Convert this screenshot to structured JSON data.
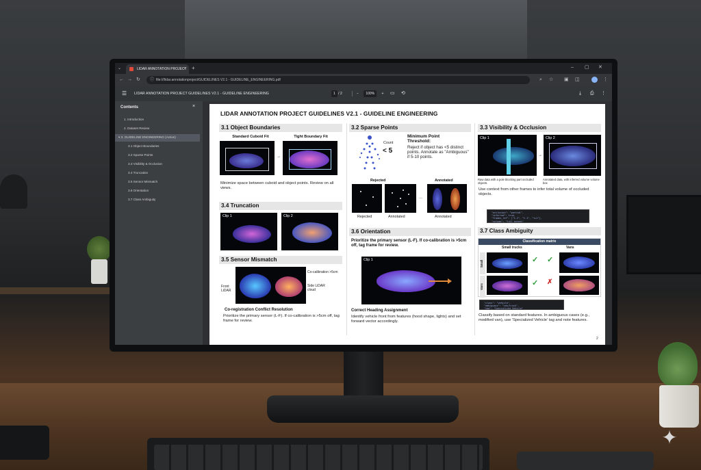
{
  "browser": {
    "tab_title": "LIDAR ANNOTATION PROJECT",
    "new_tab": "+",
    "url": "file:///lidar.annotationproject/GUIDELINES V2.1 - GUIDELINE_ENGINEERING.pdf"
  },
  "pdf_toolbar": {
    "title": "LIDAR ANNOTATION PROJECT GUIDELINES V2.1 - GUIDELINE ENGINEERING",
    "page_current": "1",
    "page_total": "/ 2",
    "zoom": "100%",
    "zoom_out": "−",
    "zoom_in": "+"
  },
  "sidebar": {
    "heading": "Contents",
    "items": [
      {
        "label": "1. Introduction"
      },
      {
        "label": "2. Dataset Review"
      },
      {
        "label": "3. GUIDELINE ENGINEERING (Active)"
      },
      {
        "label": "3.1 Object Boundaries"
      },
      {
        "label": "3.2 Sparse Points"
      },
      {
        "label": "3.3 Visibility & Occlusion"
      },
      {
        "label": "3.4 Truncation"
      },
      {
        "label": "3.5 Sensor Mismatch"
      },
      {
        "label": "3.6 Orientation"
      },
      {
        "label": "3.7 Class Ambiguity"
      }
    ]
  },
  "doc": {
    "title": "LIDAR ANNOTATION PROJECT GUIDELINES V2.1 - GUIDELINE ENGINEERING",
    "page_number": "2",
    "s31": {
      "heading": "3.1 Object Boundaries",
      "label_a": "Standard Cuboid Fit",
      "label_b": "Tight Boundary Fit",
      "arrow": "→",
      "body": "Minimize space between cuboid and object points. Review on all views."
    },
    "s32": {
      "heading": "3.2 Sparse Points",
      "count_label": "Count",
      "count_value": "< 5",
      "threshold_title": "Minimum Point Threshold:",
      "threshold_body": "Reject if object has <5 distinct points. Annotate as \"Ambiguous\" if 5-10 points.",
      "top_rejected": "Rejected",
      "top_annotated": "Annotated",
      "ellipsis": "...",
      "cap_rejected": "Rejected",
      "cap_annotated_mid": "Annotated",
      "cap_annotated_right": "Annotated"
    },
    "s33": {
      "heading": "3.3 Visibility & Occlusion",
      "clip1": "Clip 1",
      "clip2": "Clip 2",
      "cap1": "Raw data with a pole blocking part occluded objects.",
      "cap2": "Annotated data, with inferred volume volume box",
      "body": "Use context from other frames to infer total volume of occluded objects.",
      "code": "  \"occlusion\": \"partial\",\n  \"inferred\": true,\n  \"frames_ref\": [\"t-2\", \"t-1\", \"t+1\"],\n  \"volume\": \"full_extent\""
    },
    "s34": {
      "heading": "3.4 Truncation",
      "clip1": "Clip 1",
      "clip2": "Clip 2"
    },
    "s35": {
      "heading": "3.5 Sensor Mismatch",
      "front_label": "Front LiDAR",
      "side_label": "Side LiDAR cloud",
      "callout": "Co-calibration >5cm",
      "subheading": "Co-registration Conflict Resolution",
      "body": "Prioritize the primary sensor (L-F). If co-calibration is >5cm off, tag frame for review."
    },
    "s36": {
      "heading": "3.6 Orientation",
      "intro": "Prioritize the primary sensor (L-F). If co-calibration is >5cm off, tag frame for review.",
      "clip1": "Clip 1",
      "subheading": "Correct Heading Assignment",
      "body": "Identify vehicle front from features (hood shape, lights) and set forward vector accordingly."
    },
    "s37": {
      "heading": "3.7 Class Ambiguity",
      "matrix_title": "Classification matrix",
      "col_a": "Small trucks",
      "col_b": "Vans",
      "row_a": "Small",
      "row_b": "Vans",
      "check": "✓",
      "cross": "✗",
      "code": "  \"class\": \"vehicle\",\n  \"ambiguous\": \"van/truck\",\n  \"tag\": \"Specialized Vehicle\"",
      "body": "Classify based on standard features. In ambiguous cases (e.g., modified van), use 'Specialized Vehicle' tag and note features."
    }
  },
  "colors": {
    "chrome_dark": "#202124",
    "chrome_toolbar": "#35363a",
    "pdf_bar": "#323639",
    "sidebar": "#3c3f42",
    "matrix_header": "#3a4a63",
    "check_green": "#2e9c3a",
    "cross_red": "#cc2a2a"
  }
}
